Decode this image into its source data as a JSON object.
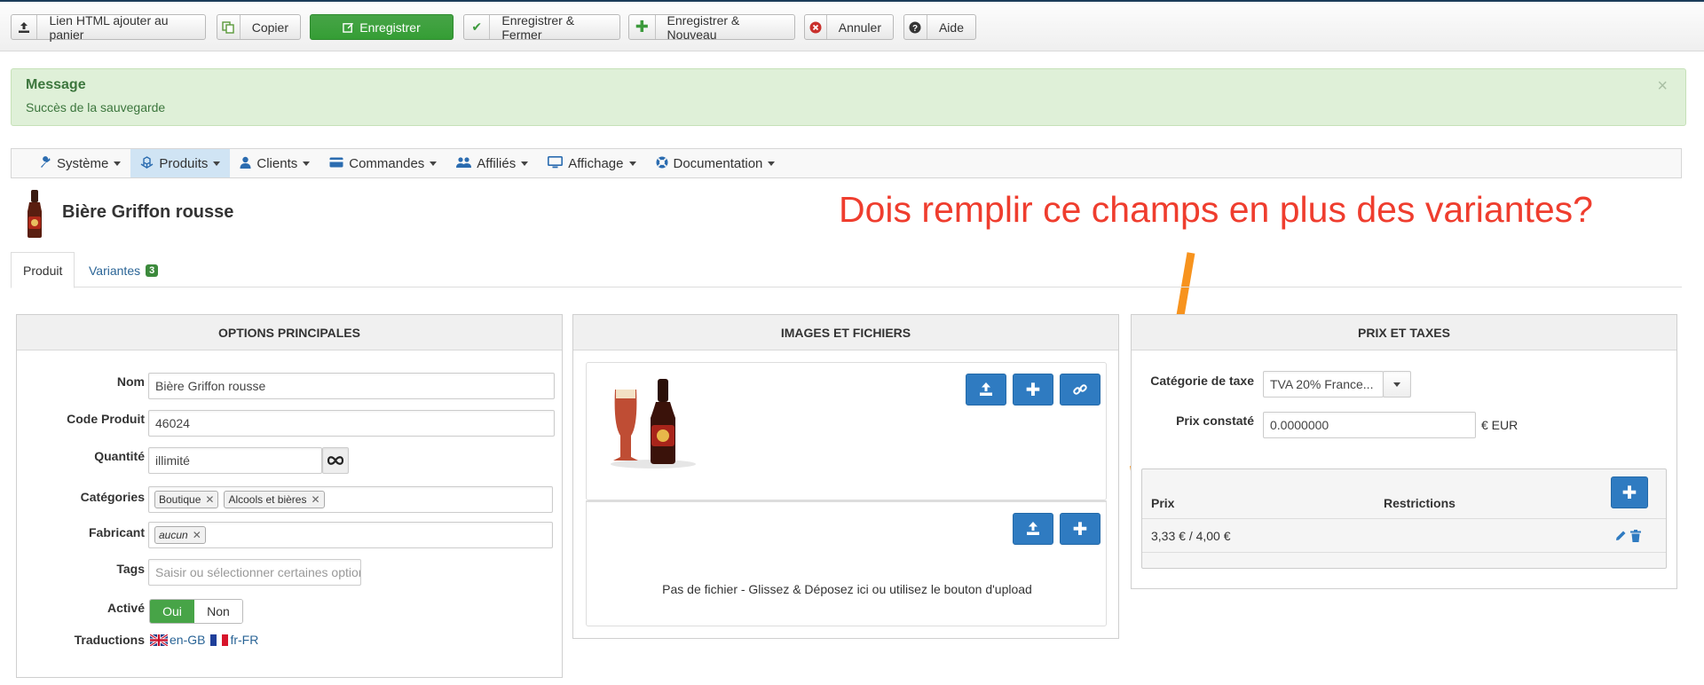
{
  "toolbar": {
    "buttons": [
      {
        "label": "Lien HTML ajouter au panier",
        "icon": "upload-icon"
      },
      {
        "label": "Copier",
        "icon": "copy-icon"
      },
      {
        "label": "Enregistrer",
        "icon": "edit-icon"
      },
      {
        "label": "Enregistrer & Fermer",
        "icon": "check-icon"
      },
      {
        "label": "Enregistrer & Nouveau",
        "icon": "plus-icon"
      },
      {
        "label": "Annuler",
        "icon": "cancel-icon"
      },
      {
        "label": "Aide",
        "icon": "help-icon"
      }
    ]
  },
  "alert": {
    "heading": "Message",
    "text": "Succès de la sauvegarde",
    "close": "×"
  },
  "nav": {
    "items": [
      {
        "label": "Système",
        "icon": "wrench-icon"
      },
      {
        "label": "Produits",
        "icon": "cubes-icon"
      },
      {
        "label": "Clients",
        "icon": "user-icon"
      },
      {
        "label": "Commandes",
        "icon": "credit-card-icon"
      },
      {
        "label": "Affiliés",
        "icon": "users-icon"
      },
      {
        "label": "Affichage",
        "icon": "monitor-icon"
      },
      {
        "label": "Documentation",
        "icon": "lifebuoy-icon"
      }
    ]
  },
  "product": {
    "title": "Bière Griffon rousse"
  },
  "annotation": {
    "text": "Dois remplir ce champs en plus des variantes?"
  },
  "tabs": {
    "produit": "Produit",
    "variantes": "Variantes",
    "variantes_count": "3"
  },
  "options": {
    "header": "OPTIONS PRINCIPALES",
    "nom_label": "Nom",
    "nom_value": "Bière Griffon rousse",
    "code_label": "Code Produit",
    "code_value": "46024",
    "quantite_label": "Quantité",
    "quantite_value": "illimité",
    "categories_label": "Catégories",
    "categories": [
      "Boutique",
      "Alcools et bières"
    ],
    "fabricant_label": "Fabricant",
    "fabricant_value": "aucun",
    "tags_label": "Tags",
    "tags_placeholder": "Saisir ou sélectionner certaines options",
    "active_label": "Activé",
    "active_on": "Oui",
    "active_off": "Non",
    "traductions_label": "Traductions",
    "trad_en": "en-GB",
    "trad_fr": "fr-FR"
  },
  "images": {
    "header": "IMAGES ET FICHIERS",
    "no_file_text": "Pas de fichier - Glissez & Déposez ici ou utilisez le bouton d'upload"
  },
  "prix": {
    "header": "PRIX ET TAXES",
    "tax_label": "Catégorie de taxe",
    "tax_value": "TVA 20% France...",
    "prix_constate_label": "Prix constaté",
    "prix_constate_value": "0.0000000",
    "currency": "€ EUR",
    "col_prix": "Prix",
    "col_restrictions": "Restrictions",
    "row_price": "3,33 € / 4,00 €"
  },
  "colors": {
    "primary": "#2f7bc1",
    "success": "#47a447",
    "annotation": "#ef3d2e",
    "arrow": "#f7931e"
  }
}
